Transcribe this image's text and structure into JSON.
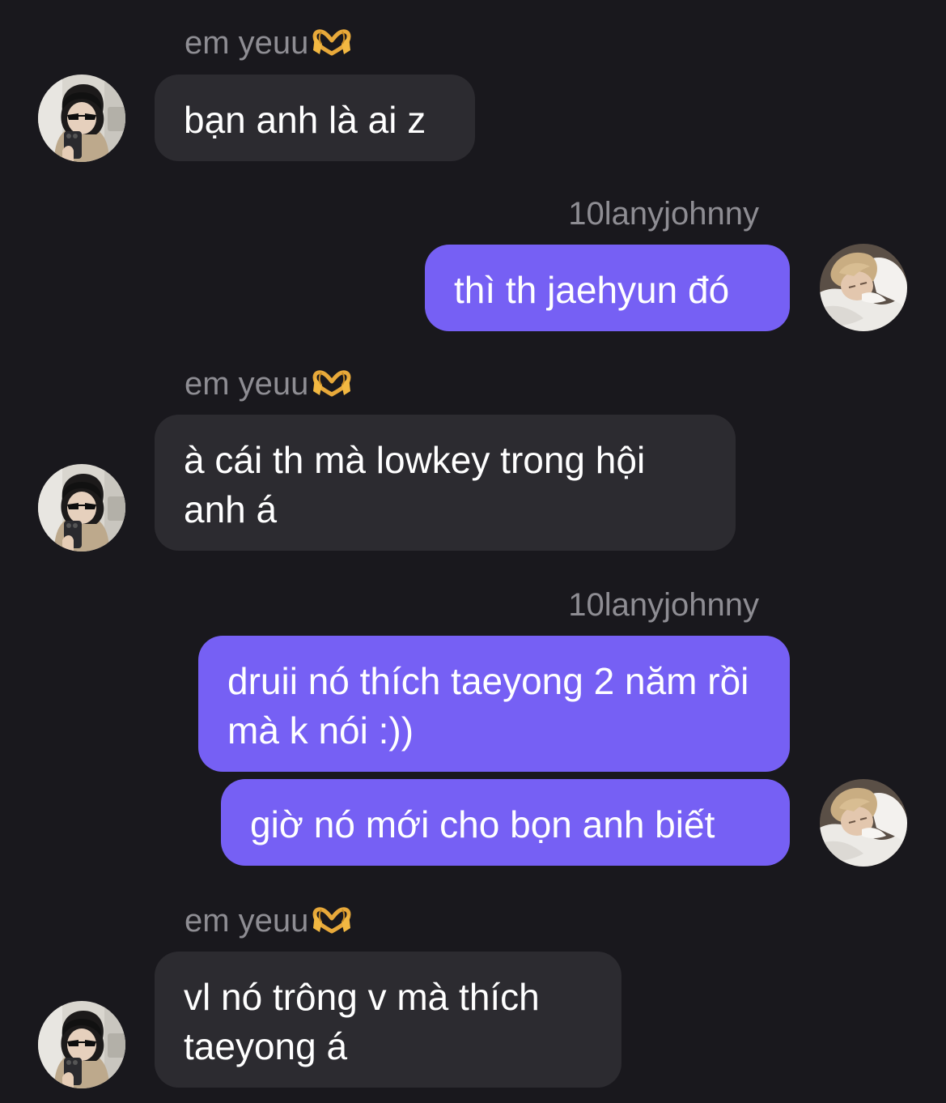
{
  "conversation": {
    "partner_name": "em yeuu",
    "self_name": "10lanyjohnny",
    "messages": [
      {
        "from": "em yeuu",
        "sender_label": "em yeuu",
        "text": "bạn anh là ai z"
      },
      {
        "from": "10lanyjohnny",
        "sender_label": "10lanyjohnny",
        "text": "thì th jaehyun đó"
      },
      {
        "from": "em yeuu",
        "sender_label": "em yeuu",
        "text": "à cái th mà lowkey trong hội anh á"
      },
      {
        "from": "10lanyjohnny",
        "sender_label": "10lanyjohnny",
        "text": "druii nó thích taeyong 2 năm rồi mà k nói :))"
      },
      {
        "from": "10lanyjohnny",
        "text": "giờ nó mới cho bọn anh biết"
      },
      {
        "from": "em yeuu",
        "sender_label": "em yeuu",
        "text": "vl nó trông v mà thích taeyong á"
      }
    ]
  },
  "icons": {
    "name_emoji": "heart-hands-icon",
    "partner_avatar": "avatar-photo",
    "self_avatar": "avatar-photo"
  },
  "colors": {
    "background": "#19181d",
    "incoming_bubble": "#2c2b30",
    "outgoing_bubble": "#7660f4",
    "sender_label": "#8e8d93",
    "text": "#ffffff"
  }
}
